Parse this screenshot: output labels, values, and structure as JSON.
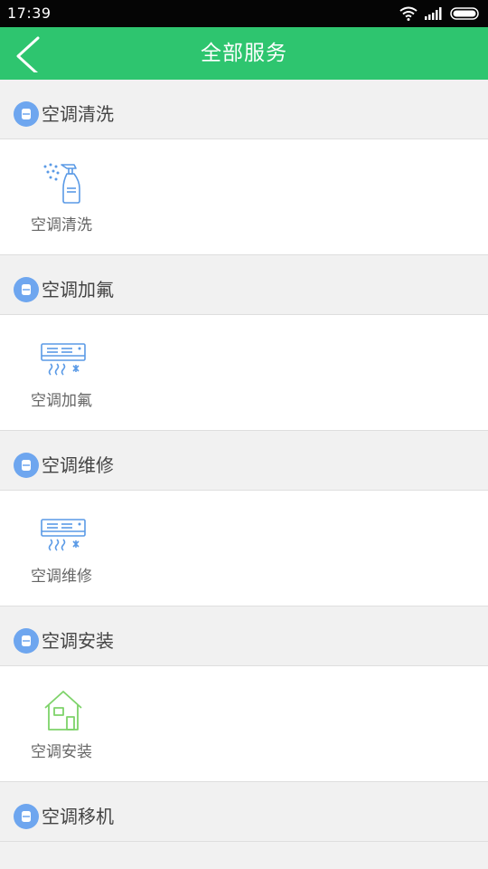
{
  "status_bar": {
    "time": "17:39"
  },
  "app_bar": {
    "title": "全部服务"
  },
  "sections": [
    {
      "title": "空调清洗",
      "items": [
        {
          "label": "空调清洗",
          "icon": "spray-bottle-icon"
        }
      ]
    },
    {
      "title": "空调加氟",
      "items": [
        {
          "label": "空调加氟",
          "icon": "air-conditioner-icon"
        }
      ]
    },
    {
      "title": "空调维修",
      "items": [
        {
          "label": "空调维修",
          "icon": "air-conditioner-icon"
        }
      ]
    },
    {
      "title": "空调安装",
      "items": [
        {
          "label": "空调安装",
          "icon": "house-icon"
        }
      ]
    },
    {
      "title": "空调移机"
    }
  ],
  "colors": {
    "primary_green": "#2ec56f",
    "badge_blue": "#6ea6ef",
    "icon_blue": "#5a9ae6",
    "icon_green": "#7ed36a"
  }
}
